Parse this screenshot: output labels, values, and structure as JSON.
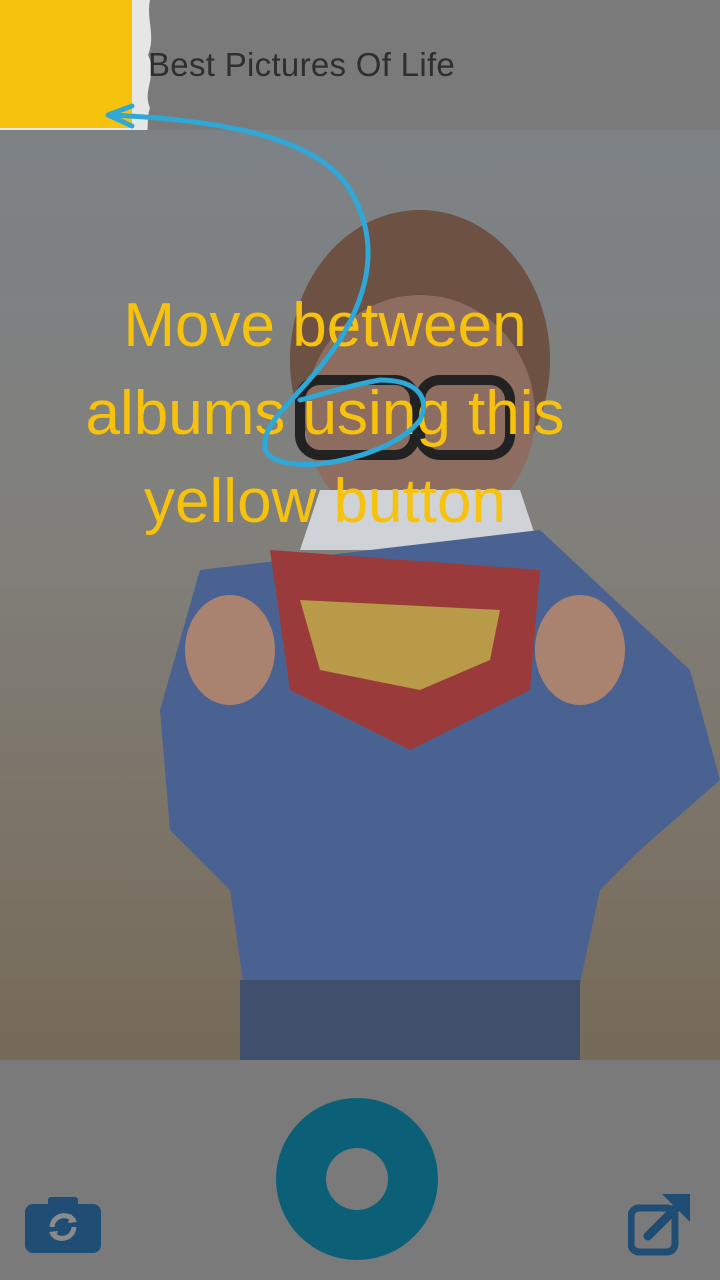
{
  "header": {
    "album_title": "Best Pictures Of Life"
  },
  "coachmark": {
    "text": "Move between albums using this yellow button"
  },
  "icons": {
    "album_switch": "yellow-square-button",
    "refresh": "camera-refresh-icon",
    "share": "external-share-icon",
    "shutter": "shutter-ring"
  },
  "colors": {
    "accent_yellow": "#f7c20e",
    "accent_teal": "#0b6078",
    "icon_blue": "#1f4d74",
    "arrow_blue": "#2ea8d6",
    "dim_gray": "#7a7a7a"
  }
}
